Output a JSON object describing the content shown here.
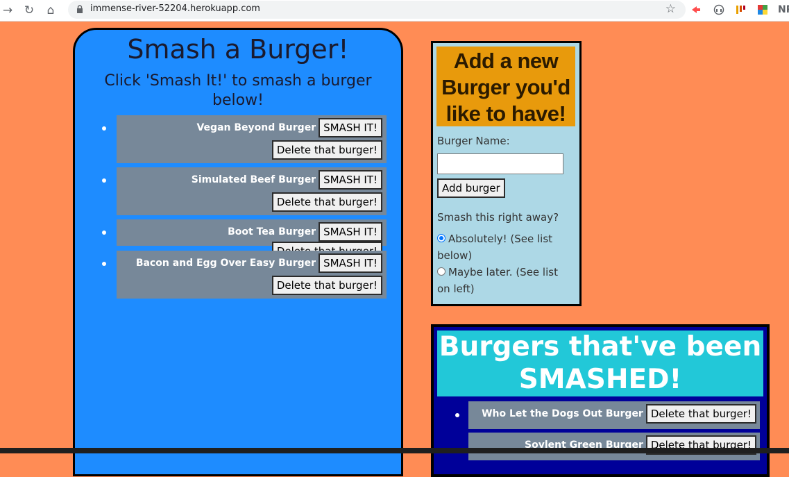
{
  "browser": {
    "url": "immense-river-52204.herokuapp.com",
    "ext_partial_label": "NP"
  },
  "left": {
    "title": "Smash a Burger!",
    "subtitle": "Click 'Smash It!' to smash a burger below!",
    "smash_label": "SMASH IT!",
    "delete_label": "Delete that burger!",
    "burgers": [
      {
        "name": "Vegan Beyond Burger"
      },
      {
        "name": "Simulated Beef Burger"
      },
      {
        "name": "Boot Tea Burger"
      },
      {
        "name": "Bacon and Egg Over Easy Burger"
      }
    ]
  },
  "add_form": {
    "heading": "Add a new Burger you'd like to have!",
    "name_label": "Burger Name:",
    "name_value": "",
    "submit_label": "Add burger",
    "question": "Smash this right away?",
    "option_yes": "Absolutely! (See list below)",
    "option_no": "Maybe later. (See list on left)",
    "selected": "yes"
  },
  "smashed": {
    "title": "Burgers that've been SMASHED!",
    "delete_label": "Delete that burger!",
    "burgers": [
      {
        "name": "Who Let the Dogs Out Burger"
      },
      {
        "name": "Soylent Green Burger"
      }
    ]
  }
}
